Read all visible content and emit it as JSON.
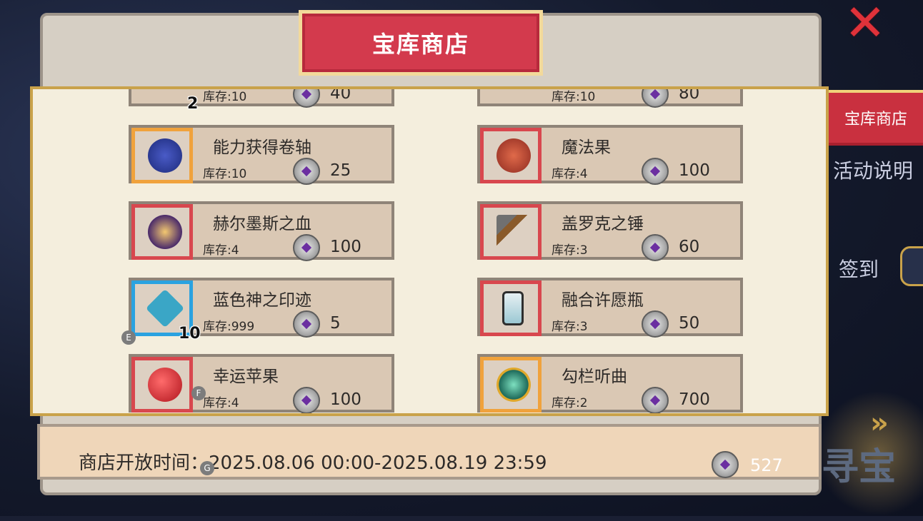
{
  "title": "宝库商店",
  "close_icon": "close-x-icon",
  "side_menu": {
    "active_tab": "宝库商店",
    "activity_info": "活动说明",
    "checkin": "签到",
    "treasure_hunt": "寻宝"
  },
  "items": [
    {
      "name": "",
      "stock": "库存:10",
      "price": "40",
      "qty": "2"
    },
    {
      "name": "",
      "stock": "库存:10",
      "price": "80",
      "qty": ""
    },
    {
      "name": "能力获得卷轴",
      "stock": "库存:10",
      "price": "25",
      "qty": "",
      "icon": "scroll-icon"
    },
    {
      "name": "魔法果",
      "stock": "库存:4",
      "price": "100",
      "qty": "",
      "icon": "magic-fruit-icon"
    },
    {
      "name": "赫尔墨斯之血",
      "stock": "库存:4",
      "price": "100",
      "qty": "",
      "icon": "potion-orb-icon"
    },
    {
      "name": "盖罗克之锤",
      "stock": "库存:3",
      "price": "60",
      "qty": "",
      "icon": "hammer-icon"
    },
    {
      "name": "蓝色神之印迹",
      "stock": "库存:999",
      "price": "5",
      "qty": "10",
      "icon": "blue-sigil-icon"
    },
    {
      "name": "融合许愿瓶",
      "stock": "库存:3",
      "price": "50",
      "qty": "",
      "icon": "wish-bottle-icon"
    },
    {
      "name": "幸运苹果",
      "stock": "库存:4",
      "price": "100",
      "qty": "",
      "icon": "apple-icon"
    },
    {
      "name": "勾栏听曲",
      "stock": "库存:2",
      "price": "700",
      "qty": "",
      "icon": "lute-icon"
    }
  ],
  "hints": [
    "E",
    "F",
    "G"
  ],
  "footer": {
    "time": "商店开放时间：2025.08.06 00:00-2025.08.19 23:59",
    "balance": "527"
  },
  "colors": {
    "accent": "#d33a4d",
    "gold": "#c9a24a",
    "panel": "#f4eedd"
  }
}
